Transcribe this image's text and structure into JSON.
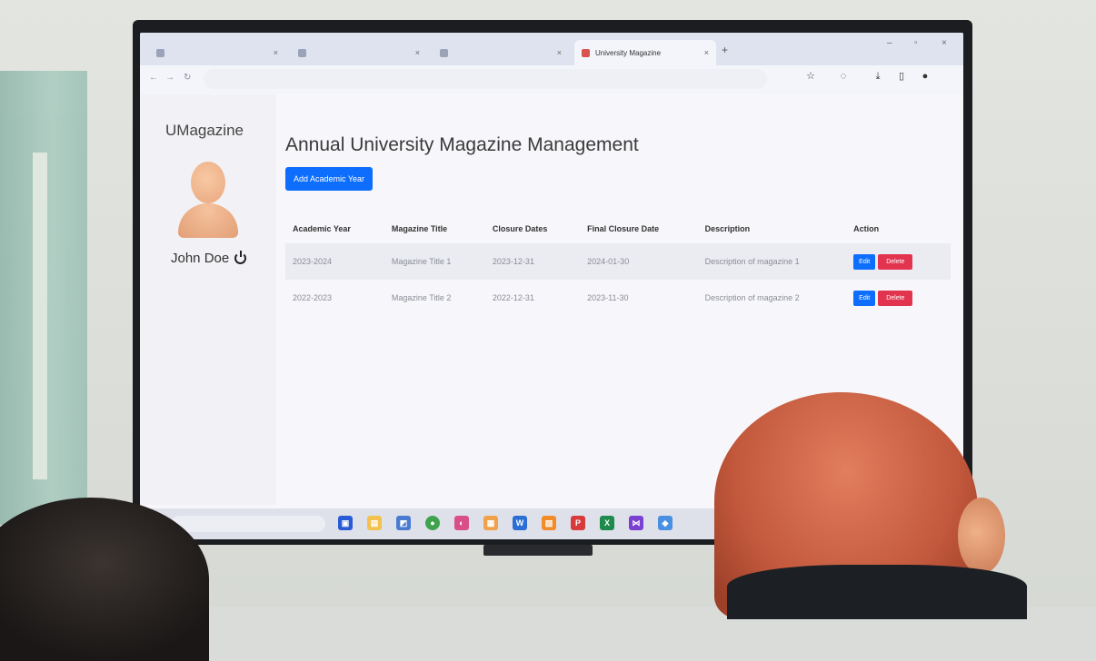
{
  "browser": {
    "tabs": [
      {
        "label": ""
      },
      {
        "label": ""
      },
      {
        "label": ""
      },
      {
        "label": "University Magazine"
      }
    ],
    "new_tab": "+",
    "toolbar_icons": [
      "star-icon",
      "extensions-icon",
      "download-icon",
      "sidebar-icon",
      "profile-icon"
    ]
  },
  "sidebar": {
    "brand": "UMagazine",
    "user_name": "John Doe",
    "items": [
      {
        "label": ""
      },
      {
        "label": ""
      },
      {
        "label": ""
      },
      {
        "label": ""
      },
      {
        "label": ""
      },
      {
        "label": ""
      },
      {
        "label": ""
      }
    ]
  },
  "main": {
    "title": "Annual University Magazine Management",
    "add_button": "Add Academic Year",
    "table": {
      "headers": [
        "Academic Year",
        "Magazine Title",
        "Closure Dates",
        "Final Closure Date",
        "Description",
        "Action"
      ],
      "rows": [
        {
          "year": "2023-2024",
          "title": "Magazine Title 1",
          "closure": "2023-12-31",
          "final": "2024-01-30",
          "description": "Description of magazine 1",
          "edit": "Edit",
          "delete": "Delete"
        },
        {
          "year": "2022-2023",
          "title": "Magazine Title 2",
          "closure": "2022-12-31",
          "final": "2023-11-30",
          "description": "Description of magazine 2",
          "edit": "Edit",
          "delete": "Delete"
        }
      ]
    }
  },
  "taskbar": {
    "search_placeholder": ""
  },
  "colors": {
    "primary": "#0d6efd",
    "danger": "#e3344f",
    "stripe": "#ebecf1"
  }
}
